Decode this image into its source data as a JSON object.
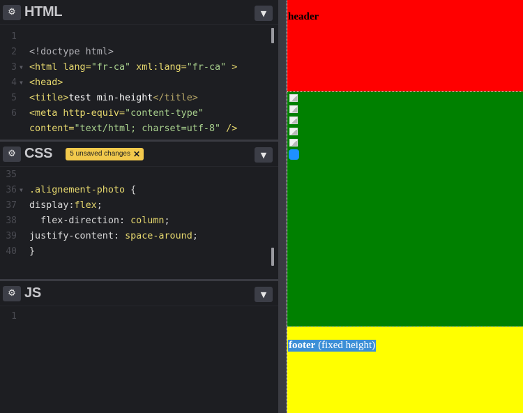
{
  "html_panel": {
    "title": "HTML",
    "gear_icon": "gear-icon",
    "collapse_icon": "chevron-down-icon",
    "lines": [
      {
        "n": "1",
        "fold": "",
        "parts": []
      },
      {
        "n": "2",
        "fold": "",
        "parts": [
          {
            "t": "<!doctype html>",
            "c": "c-doc"
          }
        ]
      },
      {
        "n": "3",
        "fold": "▼",
        "parts": [
          {
            "t": "<html",
            "c": "c-tag"
          },
          {
            "t": " lang=",
            "c": "c-attr"
          },
          {
            "t": "\"fr-ca\"",
            "c": "c-str"
          },
          {
            "t": " xml:lang=",
            "c": "c-attr"
          },
          {
            "t": "\"fr-ca\"",
            "c": "c-str"
          },
          {
            "t": " >",
            "c": "c-tag"
          }
        ]
      },
      {
        "n": "4",
        "fold": "▼",
        "parts": [
          {
            "t": "<head>",
            "c": "c-tag"
          }
        ]
      },
      {
        "n": "5",
        "fold": "",
        "parts": [
          {
            "t": "<title>",
            "c": "c-tag"
          },
          {
            "t": "test min-height",
            "c": "c-plain"
          },
          {
            "t": "</title>",
            "c": "c-tagc"
          }
        ]
      },
      {
        "n": "6",
        "fold": "",
        "parts": [
          {
            "t": "<meta",
            "c": "c-tag"
          },
          {
            "t": " http-equiv=",
            "c": "c-attr"
          },
          {
            "t": "\"content-type\"",
            "c": "c-str"
          }
        ]
      },
      {
        "n": "",
        "fold": "",
        "parts": [
          {
            "t": "content=",
            "c": "c-attr"
          },
          {
            "t": "\"text/html; charset=utf-8\"",
            "c": "c-str"
          },
          {
            "t": " />",
            "c": "c-tag"
          }
        ]
      }
    ]
  },
  "css_panel": {
    "title": "CSS",
    "badge": "5 unsaved changes",
    "badge_close": "✕",
    "gear_icon": "gear-icon",
    "collapse_icon": "chevron-down-icon",
    "lines": [
      {
        "n": "35",
        "fold": "",
        "parts": []
      },
      {
        "n": "36",
        "fold": "▼",
        "parts": [
          {
            "t": ".alignement-photo",
            "c": "c-sel"
          },
          {
            "t": " {",
            "c": "c-pun"
          }
        ]
      },
      {
        "n": "37",
        "fold": "",
        "parts": [
          {
            "t": "display",
            "c": "c-prop"
          },
          {
            "t": ":",
            "c": "c-pun"
          },
          {
            "t": "flex",
            "c": "c-val"
          },
          {
            "t": ";",
            "c": "c-pun"
          }
        ]
      },
      {
        "n": "38",
        "fold": "",
        "parts": [
          {
            "t": "  flex-direction",
            "c": "c-propb"
          },
          {
            "t": ": ",
            "c": "c-pun"
          },
          {
            "t": "column",
            "c": "c-val"
          },
          {
            "t": ";",
            "c": "c-pun"
          }
        ]
      },
      {
        "n": "39",
        "fold": "",
        "parts": [
          {
            "t": "justify-content",
            "c": "c-propb"
          },
          {
            "t": ": ",
            "c": "c-pun"
          },
          {
            "t": "space-around",
            "c": "c-val"
          },
          {
            "t": ";",
            "c": "c-pun"
          }
        ]
      },
      {
        "n": "40",
        "fold": "",
        "parts": [
          {
            "t": "}",
            "c": "c-pun"
          }
        ]
      }
    ]
  },
  "js_panel": {
    "title": "JS",
    "gear_icon": "gear-icon",
    "collapse_icon": "chevron-down-icon",
    "lines": [
      {
        "n": "1",
        "fold": "",
        "parts": []
      }
    ]
  },
  "result": {
    "header_text": "header",
    "footer_bold": "footer",
    "footer_rest": " (fixed height)",
    "images": [
      "broken-image-icon",
      "broken-image-icon",
      "broken-image-icon",
      "broken-image-icon",
      "broken-image-icon",
      "blue-image"
    ],
    "colors": {
      "header": "#ff0000",
      "main": "#008000",
      "footer": "#ffff00"
    }
  }
}
